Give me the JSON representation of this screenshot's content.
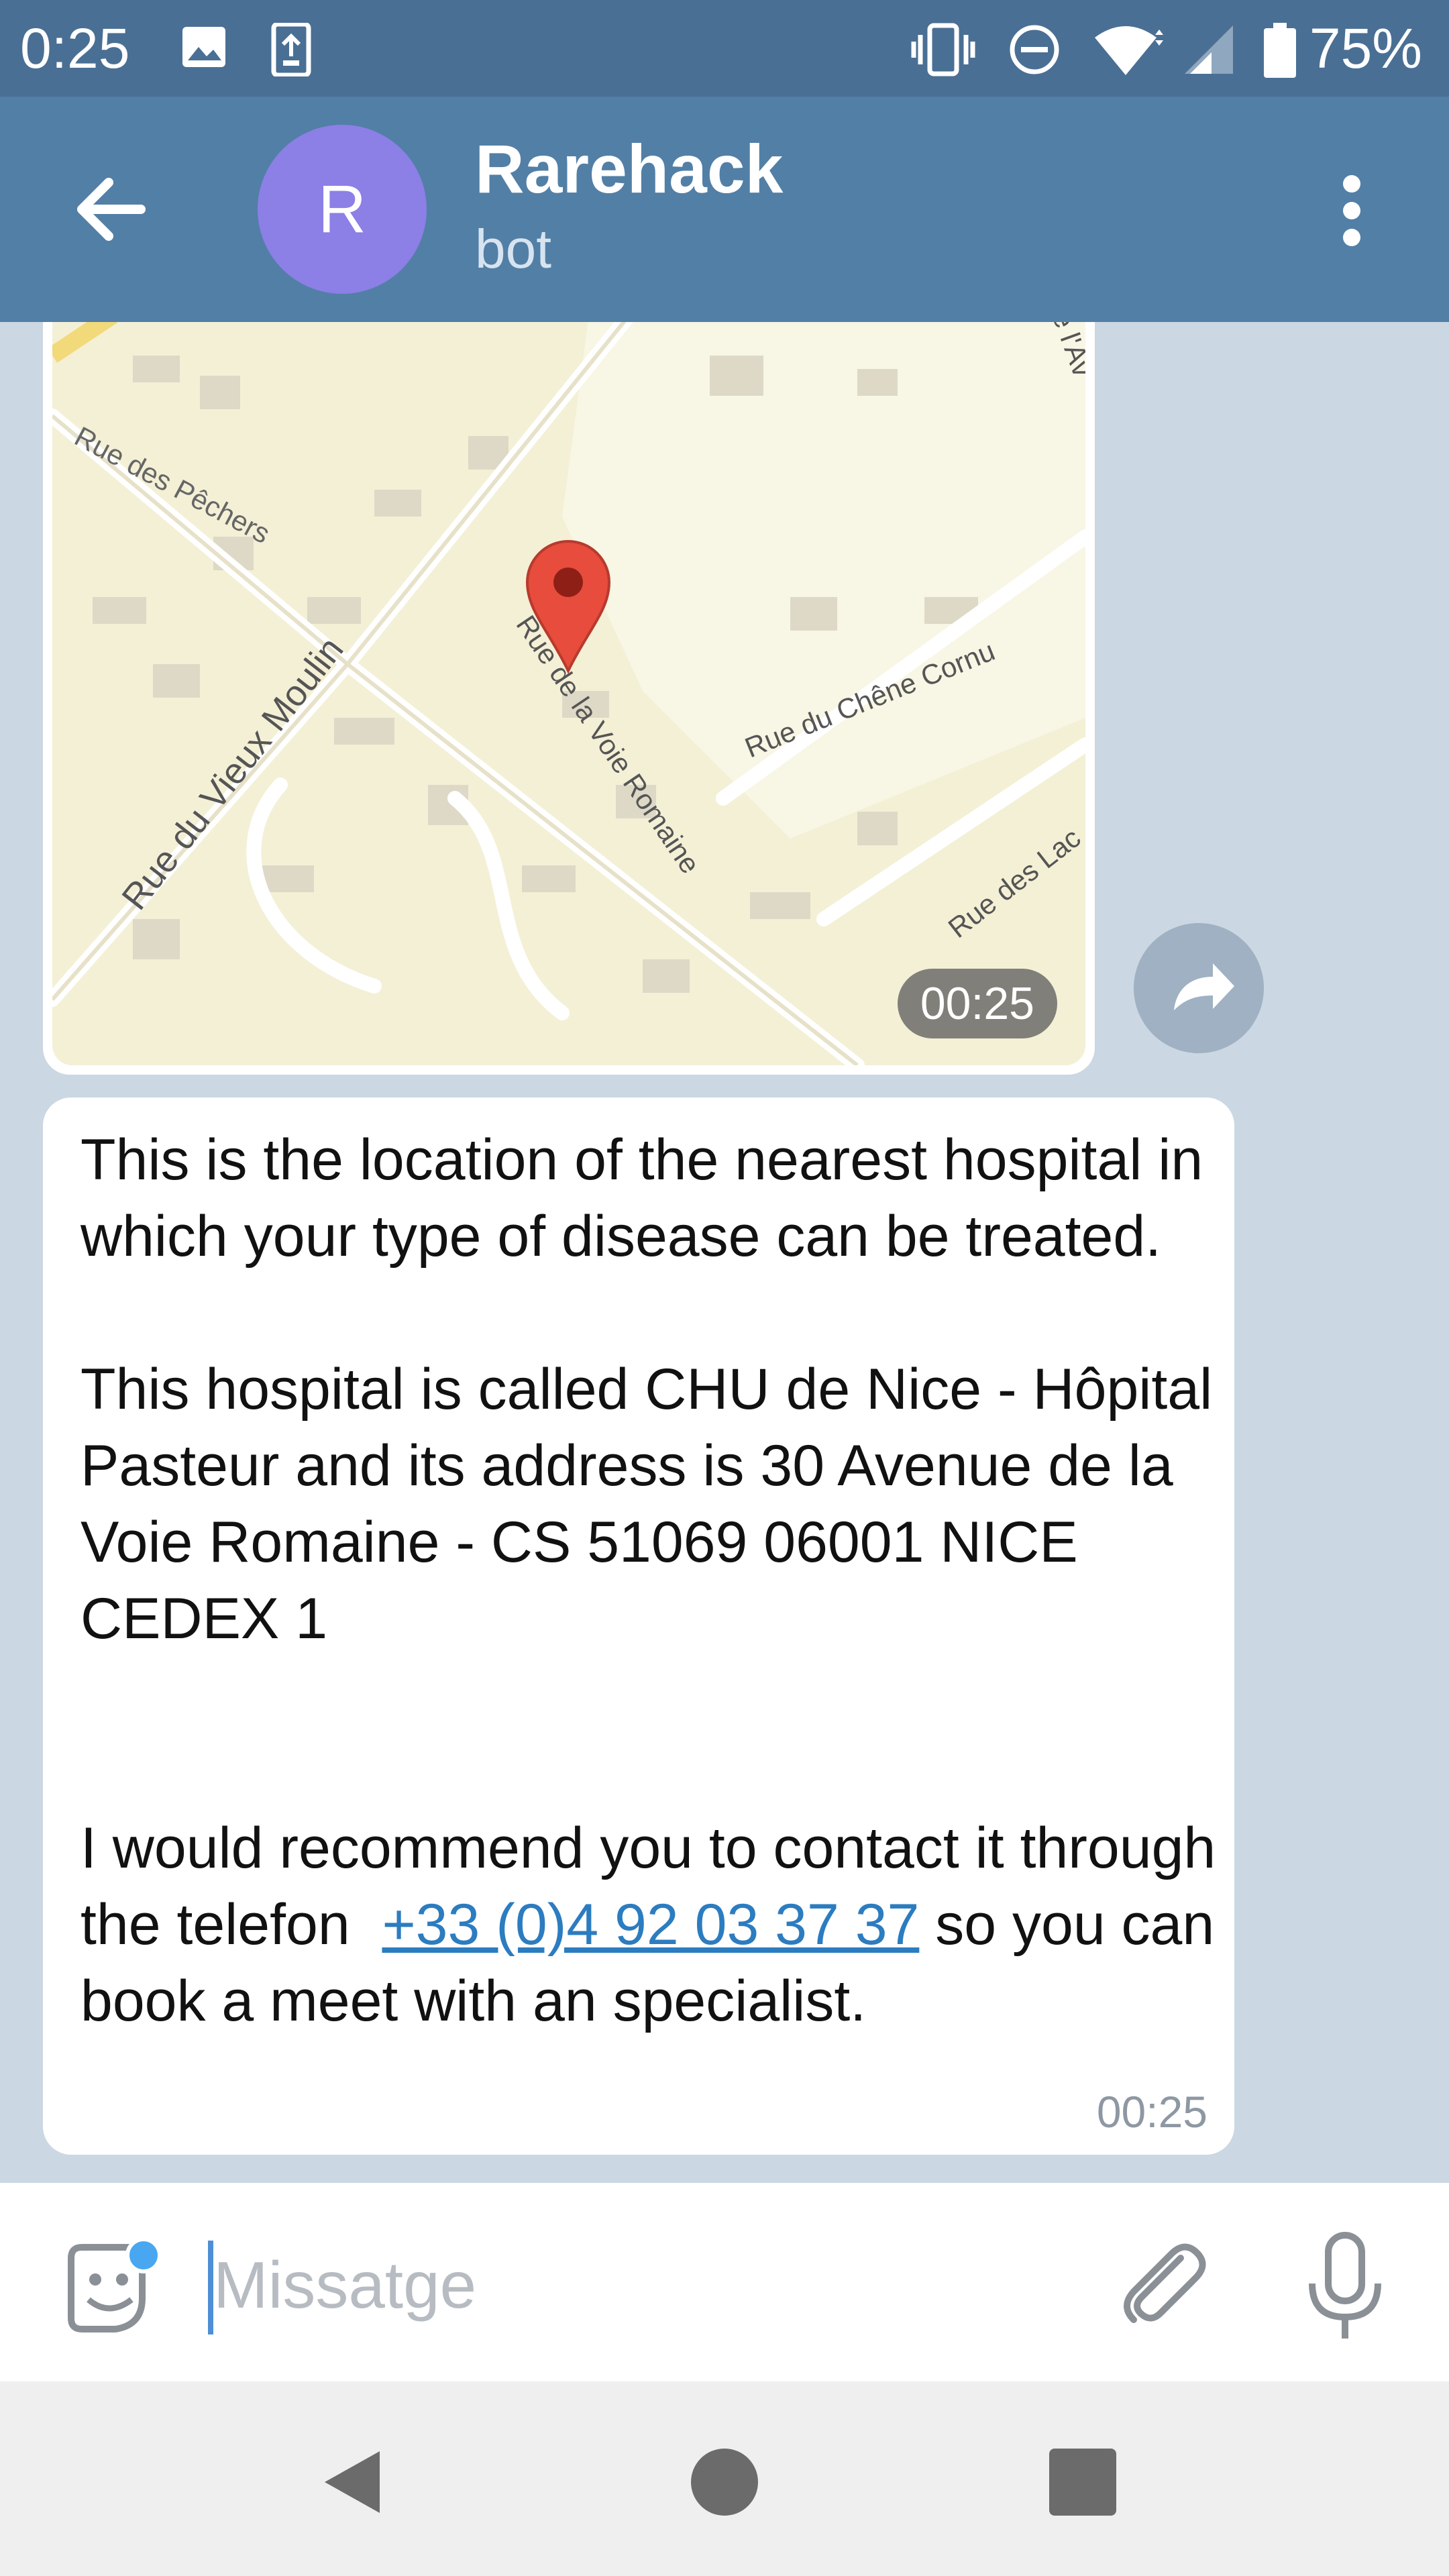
{
  "status_bar": {
    "time": "0:25",
    "battery": "75%",
    "icons": [
      "image-icon",
      "screenshot-icon",
      "vibrate-icon",
      "dnd-icon",
      "wifi-icon",
      "signal-icon",
      "battery-icon"
    ]
  },
  "header": {
    "avatar_letter": "R",
    "title": "Rarehack",
    "subtitle": "bot",
    "avatar_color": "#8c7fe6",
    "bar_color": "#527fa6"
  },
  "map_message": {
    "time": "00:25",
    "street_labels": {
      "peschers": "Rue des Pêchers",
      "vieux_moulin": "Rue du Vieux Moulin",
      "voie_romaine": "Rue de la Voie Romaine",
      "chene_cornu": "Rue du Chêne Cornu",
      "lac": "Rue des Lac",
      "top_cut": "e l'Av"
    }
  },
  "text_message": {
    "paragraph1": "This is the location of the nearest hospital in which your type of disease can be treated.",
    "paragraph2": "This hospital is called CHU de Nice - Hôpital Pasteur and its address is 30 Avenue de la Voie Romaine - CS 51069 06001 NICE CEDEX 1",
    "paragraph3_before": "I would recommend you to contact it through the telefon  ",
    "phone_link": "+33 (0)4 92 03 37 37",
    "paragraph3_after": " so you can book a meet with an specialist.",
    "time": "00:25",
    "link_color": "#2c7cc0"
  },
  "input_bar": {
    "placeholder": "Missatge"
  }
}
